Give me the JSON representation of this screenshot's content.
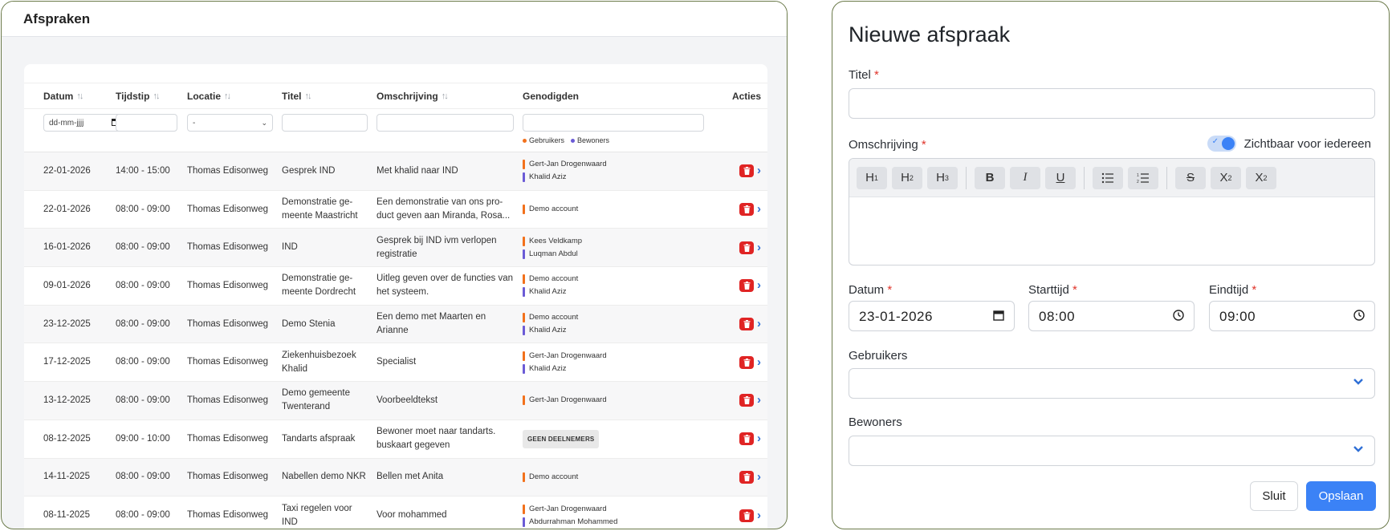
{
  "left": {
    "title": "Afspraken",
    "columns": {
      "datum": "Datum",
      "tijdstip": "Tijdstip",
      "locatie": "Locatie",
      "titel": "Titel",
      "omschrijving": "Omschrijving",
      "genodigden": "Genodigden",
      "acties": "Acties"
    },
    "filters": {
      "date_placeholder": "dd-mm-jjjj",
      "locatie_value": "-",
      "legend_gebruikers": "Gebruikers",
      "legend_bewoners": "Bewoners"
    },
    "rows": [
      {
        "datum": "22-01-2026",
        "tijd": "14:00 - 15:00",
        "locatie": "Thomas Edisonweg",
        "titel": "Gesprek IND",
        "omschrijving": "Met khalid naar IND",
        "genodigden": [
          {
            "name": "Gert-Jan Drogenwaard",
            "type": "gebruiker"
          },
          {
            "name": "Khalid Aziz",
            "type": "bewoner"
          }
        ]
      },
      {
        "datum": "22-01-2026",
        "tijd": "08:00 - 09:00",
        "locatie": "Thomas Edisonweg",
        "titel": "Demonstratie ge-meente Maastricht",
        "omschrijving": "Een demonstratie van ons pro-duct geven aan Miranda, Rosa...",
        "genodigden": [
          {
            "name": "Demo account",
            "type": "gebruiker"
          }
        ]
      },
      {
        "datum": "16-01-2026",
        "tijd": "08:00 - 09:00",
        "locatie": "Thomas Edisonweg",
        "titel": "IND",
        "omschrijving": "Gesprek bij IND ivm verlopen registratie",
        "genodigden": [
          {
            "name": "Kees Veldkamp",
            "type": "gebruiker"
          },
          {
            "name": "Luqman Abdul",
            "type": "bewoner"
          }
        ]
      },
      {
        "datum": "09-01-2026",
        "tijd": "08:00 - 09:00",
        "locatie": "Thomas Edisonweg",
        "titel": "Demonstratie ge-meente Dordrecht",
        "omschrijving": "Uitleg geven over de functies van het systeem.",
        "genodigden": [
          {
            "name": "Demo account",
            "type": "gebruiker"
          },
          {
            "name": "Khalid Aziz",
            "type": "bewoner"
          }
        ]
      },
      {
        "datum": "23-12-2025",
        "tijd": "08:00 - 09:00",
        "locatie": "Thomas Edisonweg",
        "titel": "Demo Stenia",
        "omschrijving": "Een demo met Maarten en Arianne",
        "genodigden": [
          {
            "name": "Demo account",
            "type": "gebruiker"
          },
          {
            "name": "Khalid Aziz",
            "type": "bewoner"
          }
        ]
      },
      {
        "datum": "17-12-2025",
        "tijd": "08:00 - 09:00",
        "locatie": "Thomas Edisonweg",
        "titel": "Ziekenhuisbezoek Khalid",
        "omschrijving": "Specialist",
        "genodigden": [
          {
            "name": "Gert-Jan Drogenwaard",
            "type": "gebruiker"
          },
          {
            "name": "Khalid Aziz",
            "type": "bewoner"
          }
        ]
      },
      {
        "datum": "13-12-2025",
        "tijd": "08:00 - 09:00",
        "locatie": "Thomas Edisonweg",
        "titel": "Demo gemeente Twenterand",
        "omschrijving": "Voorbeeldtekst",
        "genodigden": [
          {
            "name": "Gert-Jan Drogenwaard",
            "type": "gebruiker"
          }
        ]
      },
      {
        "datum": "08-12-2025",
        "tijd": "09:00 - 10:00",
        "locatie": "Thomas Edisonweg",
        "titel": "Tandarts afspraak",
        "omschrijving": "Bewoner moet naar tandarts. buskaart gegeven",
        "genodigden": [],
        "badge": "GEEN DEELNEMERS"
      },
      {
        "datum": "14-11-2025",
        "tijd": "08:00 - 09:00",
        "locatie": "Thomas Edisonweg",
        "titel": "Nabellen demo NKR",
        "omschrijving": "Bellen met Anita",
        "genodigden": [
          {
            "name": "Demo account",
            "type": "gebruiker"
          }
        ]
      },
      {
        "datum": "08-11-2025",
        "tijd": "08:00 - 09:00",
        "locatie": "Thomas Edisonweg",
        "titel": "Taxi regelen voor IND",
        "omschrijving": "Voor mohammed",
        "genodigden": [
          {
            "name": "Gert-Jan Drogenwaard",
            "type": "gebruiker"
          },
          {
            "name": "Abdurrahman Mohammed",
            "type": "bewoner"
          }
        ]
      }
    ],
    "colors": {
      "gebruiker": "#f2711c",
      "bewoner": "#6b5bd6",
      "delete": "#e02424",
      "chevron": "#2f6fd6"
    }
  },
  "right": {
    "title": "Nieuwe afspraak",
    "titel_label": "Titel",
    "omschrijving_label": "Omschrijving",
    "zichtbaar_label": "Zichtbaar voor iedereen",
    "zichtbaar_on": true,
    "toolbar": [
      "H1",
      "H2",
      "H3",
      "B",
      "I",
      "U",
      "bullet-list",
      "numbered-list",
      "S",
      "X₂",
      "X²"
    ],
    "datum_label": "Datum",
    "datum_value": "23-01-2026",
    "starttijd_label": "Starttijd",
    "starttijd_value": "08:00",
    "eindtijd_label": "Eindtijd",
    "eindtijd_value": "09:00",
    "gebruikers_label": "Gebruikers",
    "bewoners_label": "Bewoners",
    "sluit_label": "Sluit",
    "opslaan_label": "Opslaan",
    "required_mark": "*",
    "accent": "#3b82f6"
  }
}
